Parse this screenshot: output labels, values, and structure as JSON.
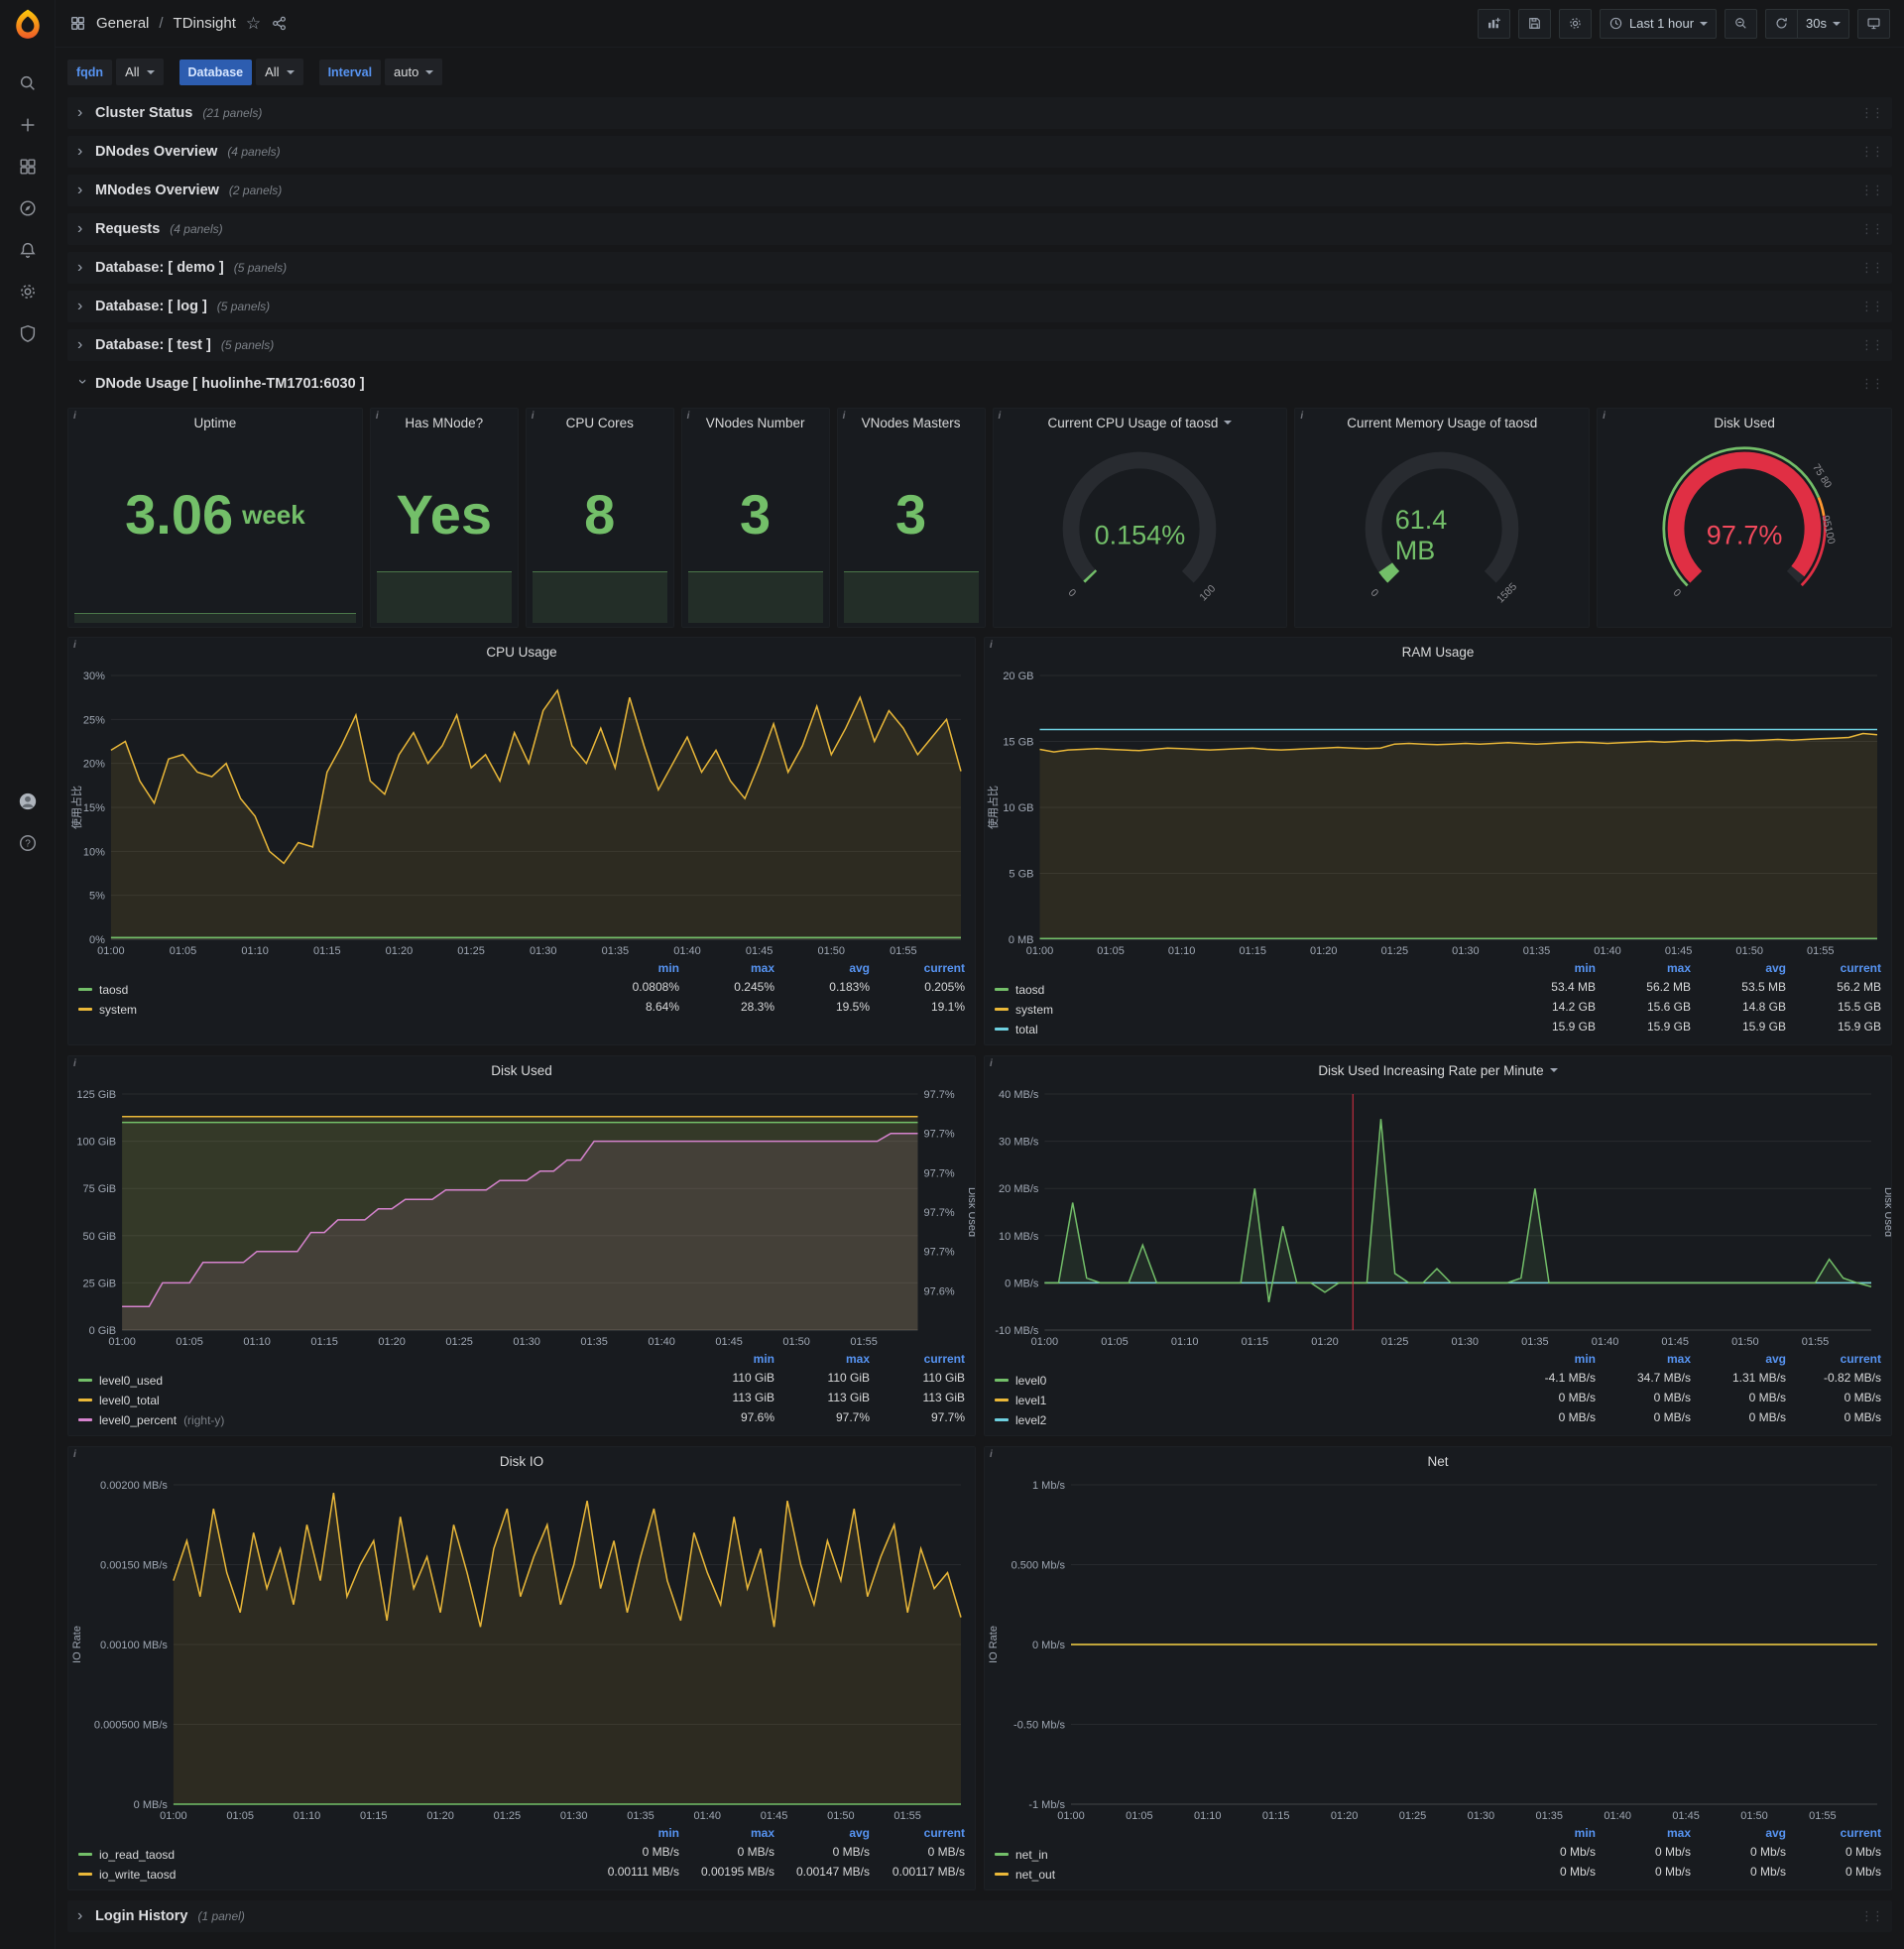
{
  "topbar": {
    "section": "General",
    "separator": "/",
    "title": "TDinsight",
    "time_range": "Last 1 hour",
    "refresh": "30s"
  },
  "filters": [
    {
      "label": "fqdn",
      "value": "All"
    },
    {
      "label": "Database",
      "value": "All"
    },
    {
      "label": "Interval",
      "value": "auto"
    }
  ],
  "rows": [
    {
      "title": "Cluster Status",
      "count": "(21 panels)"
    },
    {
      "title": "DNodes Overview",
      "count": "(4 panels)"
    },
    {
      "title": "MNodes Overview",
      "count": "(2 panels)"
    },
    {
      "title": "Requests",
      "count": "(4 panels)"
    },
    {
      "title": "Database: [ demo ]",
      "count": "(5 panels)"
    },
    {
      "title": "Database: [ log ]",
      "count": "(5 panels)"
    },
    {
      "title": "Database: [ test ]",
      "count": "(5 panels)"
    }
  ],
  "dnode_row": {
    "title": "DNode Usage [ huolinhe-TM1701:6030 ]"
  },
  "login_row": {
    "title": "Login History",
    "count": "(1 panel)"
  },
  "stats": [
    {
      "title": "Uptime",
      "value": "3.06",
      "unit": "week"
    },
    {
      "title": "Has MNode?",
      "value": "Yes"
    },
    {
      "title": "CPU Cores",
      "value": "8"
    },
    {
      "title": "VNodes Number",
      "value": "3"
    },
    {
      "title": "VNodes Masters",
      "value": "3"
    }
  ],
  "gauges": {
    "cpu": {
      "title": "Current CPU Usage of taosd",
      "value": "0.154%",
      "min": "0",
      "max": "100",
      "fraction": 0.0015,
      "color": "#73bf69",
      "value_color": "#73bf69"
    },
    "mem": {
      "title": "Current Memory Usage of taosd",
      "value": "61.4 MB",
      "min": "0",
      "max": "1585",
      "fraction": 0.0387,
      "color": "#73bf69",
      "value_color": "#73bf69"
    },
    "disk": {
      "title": "Disk Used",
      "value": "97.7%",
      "min": "0",
      "fraction": 0.977,
      "color": "#e02f44",
      "value_color": "#f2495c",
      "thresh_top": "75 80",
      "thresh_side": "95100"
    }
  },
  "accent_colors": {
    "green": "#73bf69",
    "yellow": "#eab839",
    "cyan": "#6ed0e0",
    "pink": "#d683ce",
    "red": "#e02f44",
    "blue": "#5794f2"
  },
  "charts": {
    "shared_xticks": [
      "01:00",
      "01:05",
      "01:10",
      "01:15",
      "01:20",
      "01:25",
      "01:30",
      "01:35",
      "01:40",
      "01:45",
      "01:50",
      "01:55"
    ],
    "cpu_usage": {
      "title": "CPU Usage",
      "ylabel": "使用占比",
      "ylim": [
        0,
        30
      ],
      "yticks": [
        {
          "v": 0,
          "t": "0%"
        },
        {
          "v": 5,
          "t": "5%"
        },
        {
          "v": 10,
          "t": "10%"
        },
        {
          "v": 15,
          "t": "15%"
        },
        {
          "v": 20,
          "t": "20%"
        },
        {
          "v": 25,
          "t": "25%"
        },
        {
          "v": 30,
          "t": "30%"
        }
      ],
      "series": [
        {
          "name": "system",
          "color": "#eab839",
          "fill": true,
          "values": [
            21.5,
            22.5,
            18,
            15.5,
            20.5,
            21,
            19,
            18.5,
            20,
            16,
            14,
            10,
            8.64,
            11,
            10.5,
            19,
            22,
            25.5,
            18,
            16.5,
            21,
            23.5,
            20,
            22,
            25.5,
            19.5,
            21,
            18,
            23.5,
            20,
            26,
            28.3,
            22,
            20,
            24,
            19.5,
            27.5,
            22,
            17,
            20,
            23,
            19,
            21.5,
            18,
            16,
            20,
            24.5,
            19,
            22,
            26.5,
            21,
            24,
            27.5,
            22.5,
            26,
            24,
            21,
            23,
            25,
            19.1
          ]
        },
        {
          "name": "taosd",
          "color": "#73bf69",
          "fill": true,
          "values": {
            "const": 0.2,
            "n": 60
          }
        }
      ],
      "legend": {
        "cols": [
          "min",
          "max",
          "avg",
          "current"
        ],
        "rows": [
          {
            "name": "taosd",
            "color": "#73bf69",
            "vals": [
              "0.0808%",
              "0.245%",
              "0.183%",
              "0.205%"
            ]
          },
          {
            "name": "system",
            "color": "#eab839",
            "vals": [
              "8.64%",
              "28.3%",
              "19.5%",
              "19.1%"
            ]
          }
        ]
      }
    },
    "ram_usage": {
      "title": "RAM Usage",
      "ylabel": "使用占比",
      "ylim": [
        0,
        20
      ],
      "yticks": [
        {
          "v": 0,
          "t": "0 MB"
        },
        {
          "v": 5,
          "t": "5 GB"
        },
        {
          "v": 10,
          "t": "10 GB"
        },
        {
          "v": 15,
          "t": "15 GB"
        },
        {
          "v": 20,
          "t": "20 GB"
        }
      ],
      "series": [
        {
          "name": "system",
          "color": "#eab839",
          "fill": true,
          "values": [
            14.4,
            14.2,
            14.35,
            14.4,
            14.45,
            14.4,
            14.35,
            14.3,
            14.4,
            14.5,
            14.45,
            14.4,
            14.35,
            14.4,
            14.45,
            14.5,
            14.4,
            14.35,
            14.4,
            14.45,
            14.5,
            14.55,
            14.5,
            14.45,
            14.5,
            14.8,
            14.85,
            14.8,
            14.75,
            14.8,
            14.85,
            14.8,
            14.85,
            14.9,
            14.85,
            14.8,
            14.85,
            14.9,
            14.95,
            14.9,
            14.85,
            14.9,
            14.95,
            15,
            14.95,
            15,
            15.05,
            15,
            15.05,
            15.1,
            15.05,
            15.1,
            15.15,
            15.1,
            15.15,
            15.2,
            15.25,
            15.3,
            15.6,
            15.5
          ]
        },
        {
          "name": "taosd",
          "color": "#73bf69",
          "fill": true,
          "values": {
            "const": 0.05,
            "n": 60
          }
        },
        {
          "name": "total",
          "color": "#6ed0e0",
          "fill": false,
          "values": {
            "const": 15.9,
            "n": 60
          }
        }
      ],
      "legend": {
        "cols": [
          "min",
          "max",
          "avg",
          "current"
        ],
        "rows": [
          {
            "name": "taosd",
            "color": "#73bf69",
            "vals": [
              "53.4 MB",
              "56.2 MB",
              "53.5 MB",
              "56.2 MB"
            ]
          },
          {
            "name": "system",
            "color": "#eab839",
            "vals": [
              "14.2 GB",
              "15.6 GB",
              "14.8 GB",
              "15.5 GB"
            ]
          },
          {
            "name": "total",
            "color": "#6ed0e0",
            "vals": [
              "15.9 GB",
              "15.9 GB",
              "15.9 GB",
              "15.9 GB"
            ]
          }
        ]
      }
    },
    "disk_used": {
      "title": "Disk Used",
      "ylim": [
        0,
        125
      ],
      "yticks": [
        {
          "v": 0,
          "t": "0 GiB"
        },
        {
          "v": 25,
          "t": "25 GiB"
        },
        {
          "v": 50,
          "t": "50 GiB"
        },
        {
          "v": 75,
          "t": "75 GiB"
        },
        {
          "v": 100,
          "t": "100 GiB"
        },
        {
          "v": 125,
          "t": "125 GiB"
        }
      ],
      "right_ylim": [
        97.575,
        97.725
      ],
      "right_label": "Disk Used",
      "right_yticks": [
        {
          "v": 97.6,
          "t": "97.6%"
        },
        {
          "v": 97.625,
          "t": "97.7%"
        },
        {
          "v": 97.65,
          "t": "97.7%"
        },
        {
          "v": 97.675,
          "t": "97.7%"
        },
        {
          "v": 97.7,
          "t": "97.7%"
        },
        {
          "v": 97.725,
          "t": "97.7%"
        }
      ],
      "series": [
        {
          "name": "level0_total",
          "color": "#eab839",
          "fill": true,
          "values": {
            "const": 113,
            "n": 60
          }
        },
        {
          "name": "level0_used",
          "color": "#73bf69",
          "fill": true,
          "values": {
            "const": 110,
            "n": 60
          }
        },
        {
          "name": "level0_percent",
          "color": "#d683ce",
          "fill": true,
          "axis": "right",
          "values": [
            97.59,
            97.59,
            97.59,
            97.605,
            97.605,
            97.605,
            97.618,
            97.618,
            97.618,
            97.618,
            97.625,
            97.625,
            97.625,
            97.625,
            97.637,
            97.637,
            97.645,
            97.645,
            97.645,
            97.652,
            97.652,
            97.658,
            97.658,
            97.658,
            97.664,
            97.664,
            97.664,
            97.664,
            97.67,
            97.67,
            97.67,
            97.676,
            97.676,
            97.683,
            97.683,
            97.695,
            97.695,
            97.695,
            97.695,
            97.695,
            97.695,
            97.695,
            97.695,
            97.695,
            97.695,
            97.695,
            97.695,
            97.695,
            97.695,
            97.695,
            97.695,
            97.695,
            97.695,
            97.695,
            97.695,
            97.695,
            97.695,
            97.7,
            97.7,
            97.7
          ]
        }
      ],
      "legend": {
        "cols": [
          "min",
          "max",
          "current"
        ],
        "rows": [
          {
            "name": "level0_used",
            "color": "#73bf69",
            "vals": [
              "110 GiB",
              "110 GiB",
              "110 GiB"
            ]
          },
          {
            "name": "level0_total",
            "color": "#eab839",
            "vals": [
              "113 GiB",
              "113 GiB",
              "113 GiB"
            ]
          },
          {
            "name": "level0_percent",
            "color": "#d683ce",
            "note": "(right-y)",
            "vals": [
              "97.6%",
              "97.7%",
              "97.7%"
            ]
          }
        ]
      }
    },
    "disk_rate": {
      "title": "Disk Used Increasing Rate per Minute",
      "ylim": [
        -10,
        40
      ],
      "right_label": "Disk Used",
      "annotation_x": 22,
      "yticks": [
        {
          "v": -10,
          "t": "-10 MB/s"
        },
        {
          "v": 0,
          "t": "0 MB/s"
        },
        {
          "v": 10,
          "t": "10 MB/s"
        },
        {
          "v": 20,
          "t": "20 MB/s"
        },
        {
          "v": 30,
          "t": "30 MB/s"
        },
        {
          "v": 40,
          "t": "40 MB/s"
        }
      ],
      "series": [
        {
          "name": "level1",
          "color": "#eab839",
          "fill": false,
          "values": {
            "const": 0,
            "n": 60
          }
        },
        {
          "name": "level2",
          "color": "#6ed0e0",
          "fill": false,
          "values": {
            "const": 0,
            "n": 60
          }
        },
        {
          "name": "level0",
          "color": "#73bf69",
          "fill": true,
          "values": [
            0,
            0,
            17,
            1,
            0,
            0,
            0,
            8,
            0,
            0,
            0,
            0,
            0,
            0,
            0,
            20,
            -4.1,
            12,
            0,
            0,
            -2,
            0,
            0,
            0,
            34.7,
            2,
            0,
            0,
            3,
            0,
            0,
            0,
            0,
            0,
            1,
            20,
            0,
            0,
            0,
            0,
            0,
            0,
            0,
            0,
            0,
            0,
            0,
            0,
            0,
            0,
            0,
            0,
            0,
            0,
            0,
            0,
            5,
            1,
            0,
            -0.82
          ]
        }
      ],
      "legend": {
        "cols": [
          "min",
          "max",
          "avg",
          "current"
        ],
        "rows": [
          {
            "name": "level0",
            "color": "#73bf69",
            "vals": [
              "-4.1 MB/s",
              "34.7 MB/s",
              "1.31 MB/s",
              "-0.82 MB/s"
            ]
          },
          {
            "name": "level1",
            "color": "#eab839",
            "vals": [
              "0 MB/s",
              "0 MB/s",
              "0 MB/s",
              "0 MB/s"
            ]
          },
          {
            "name": "level2",
            "color": "#6ed0e0",
            "vals": [
              "0 MB/s",
              "0 MB/s",
              "0 MB/s",
              "0 MB/s"
            ]
          }
        ]
      }
    },
    "disk_io": {
      "title": "Disk IO",
      "ylabel": "IO Rate",
      "ylim": [
        0,
        0.002
      ],
      "yticks": [
        {
          "v": 0,
          "t": "0 MB/s"
        },
        {
          "v": 0.0005,
          "t": "0.000500 MB/s"
        },
        {
          "v": 0.001,
          "t": "0.00100 MB/s"
        },
        {
          "v": 0.0015,
          "t": "0.00150 MB/s"
        },
        {
          "v": 0.002,
          "t": "0.00200 MB/s"
        }
      ],
      "series": [
        {
          "name": "io_write_taosd",
          "color": "#eab839",
          "fill": true,
          "values": [
            0.0014,
            0.00165,
            0.0013,
            0.00185,
            0.00145,
            0.0012,
            0.0017,
            0.00135,
            0.0016,
            0.00125,
            0.00175,
            0.0014,
            0.00195,
            0.0013,
            0.0015,
            0.00165,
            0.00115,
            0.0018,
            0.00135,
            0.00155,
            0.0012,
            0.00175,
            0.00145,
            0.00111,
            0.0016,
            0.00185,
            0.0013,
            0.00155,
            0.00175,
            0.00125,
            0.0015,
            0.0019,
            0.00135,
            0.00165,
            0.0012,
            0.00155,
            0.00185,
            0.0014,
            0.00115,
            0.0017,
            0.00145,
            0.00125,
            0.0018,
            0.00135,
            0.0016,
            0.00111,
            0.0019,
            0.0015,
            0.00125,
            0.00165,
            0.0014,
            0.00185,
            0.0013,
            0.00155,
            0.00175,
            0.0012,
            0.0016,
            0.00135,
            0.00145,
            0.00117
          ]
        },
        {
          "name": "io_read_taosd",
          "color": "#73bf69",
          "fill": true,
          "values": {
            "const": 0,
            "n": 60
          }
        }
      ],
      "legend": {
        "cols": [
          "min",
          "max",
          "avg",
          "current"
        ],
        "rows": [
          {
            "name": "io_read_taosd",
            "color": "#73bf69",
            "vals": [
              "0 MB/s",
              "0 MB/s",
              "0 MB/s",
              "0 MB/s"
            ]
          },
          {
            "name": "io_write_taosd",
            "color": "#eab839",
            "vals": [
              "0.00111 MB/s",
              "0.00195 MB/s",
              "0.00147 MB/s",
              "0.00117 MB/s"
            ]
          }
        ]
      }
    },
    "net": {
      "title": "Net",
      "ylabel": "IO Rate",
      "ylim": [
        -1,
        1
      ],
      "yticks": [
        {
          "v": -1,
          "t": "-1 Mb/s"
        },
        {
          "v": -0.5,
          "t": "-0.50 Mb/s"
        },
        {
          "v": 0,
          "t": "0 Mb/s"
        },
        {
          "v": 0.5,
          "t": "0.500 Mb/s"
        },
        {
          "v": 1,
          "t": "1 Mb/s"
        }
      ],
      "series": [
        {
          "name": "net_in",
          "color": "#73bf69",
          "fill": false,
          "values": {
            "const": 0,
            "n": 60
          }
        },
        {
          "name": "net_out",
          "color": "#eab839",
          "fill": false,
          "values": {
            "const": 0,
            "n": 60
          }
        }
      ],
      "legend": {
        "cols": [
          "min",
          "max",
          "avg",
          "current"
        ],
        "rows": [
          {
            "name": "net_in",
            "color": "#73bf69",
            "vals": [
              "0 Mb/s",
              "0 Mb/s",
              "0 Mb/s",
              "0 Mb/s"
            ]
          },
          {
            "name": "net_out",
            "color": "#eab839",
            "vals": [
              "0 Mb/s",
              "0 Mb/s",
              "0 Mb/s",
              "0 Mb/s"
            ]
          }
        ]
      }
    }
  }
}
